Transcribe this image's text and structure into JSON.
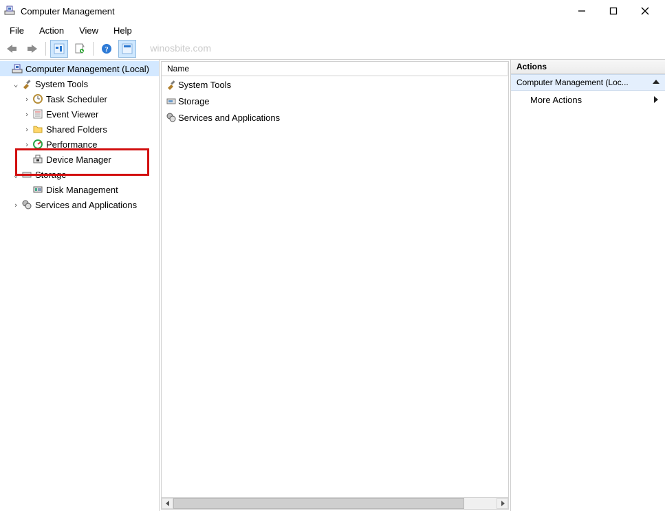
{
  "window": {
    "title": "Computer Management"
  },
  "menubar": {
    "items": [
      "File",
      "Action",
      "View",
      "Help"
    ]
  },
  "watermark": "winosbite.com",
  "tree": {
    "root": {
      "label": "Computer Management (Local)",
      "children": [
        {
          "label": "System Tools",
          "expanded": true,
          "children": [
            {
              "label": "Task Scheduler"
            },
            {
              "label": "Event Viewer"
            },
            {
              "label": "Shared Folders"
            },
            {
              "label": "Performance"
            },
            {
              "label": "Device Manager",
              "highlighted": true
            }
          ]
        },
        {
          "label": "Storage",
          "expanded": true,
          "children": [
            {
              "label": "Disk Management"
            }
          ]
        },
        {
          "label": "Services and Applications",
          "expanded": false
        }
      ]
    }
  },
  "list": {
    "columns": [
      "Name"
    ],
    "rows": [
      "System Tools",
      "Storage",
      "Services and Applications"
    ]
  },
  "actions": {
    "header": "Actions",
    "section": "Computer Management (Loc...",
    "more": "More Actions"
  }
}
